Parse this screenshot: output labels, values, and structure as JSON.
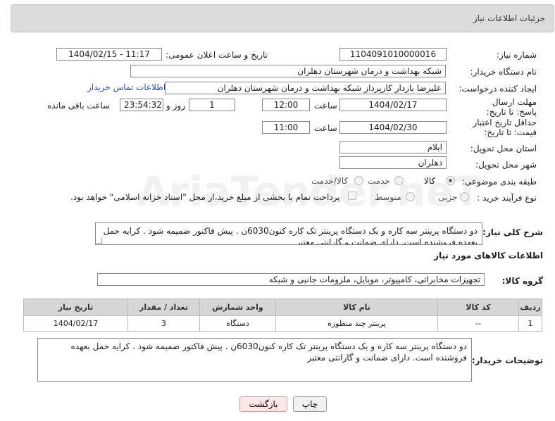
{
  "header": {
    "title": "جزئیات اطلاعات نیاز"
  },
  "fields": {
    "need_number_label": "شماره نیاز:",
    "need_number": "1104091010000016",
    "announce_label": "تاریخ و ساعت اعلان عمومی:",
    "announce_value": "1404/02/15 - 11:17",
    "buyer_org_label": "نام دستگاه خریدار:",
    "buyer_org": "شبکه بهداشت و درمان شهرستان دهلران",
    "creator_label": "ایجاد کننده درخواست:",
    "creator": "علیرضا بازدار کارپرداز شبکه بهداشت و درمان شهرستان دهلران",
    "buyer_contact_link": "اطلاعات تماس خریدار",
    "deadline_label": "مهلت ارسال پاسخ: تا تاریخ:",
    "deadline_date": "1404/02/17",
    "time_label": "ساعت",
    "deadline_time": "12:00",
    "days_value": "1",
    "days_label": "روز و",
    "remaining_value": "23:54:32",
    "remaining_label": "ساعت باقی مانده",
    "price_validity_label": "حداقل تاریخ اعتبار قیمت: تا تاریخ:",
    "price_date": "1404/02/30",
    "price_time": "11:00",
    "province_label": "استان محل تحویل:",
    "province": "ایلام",
    "city_label": "شهر محل تحویل:",
    "city": "دهلران",
    "category_label": "طبقه بندی موضوعی:",
    "cat_goods": "کالا",
    "cat_service": "خدمت",
    "cat_goods_service": "کالا/خدمت",
    "process_label": "نوع فرآیند خرید :",
    "proc_partial": "جزیی",
    "proc_medium": "متوسط",
    "payment_note": "پرداخت تمام یا بخشی از مبلغ خرید،از محل \"اسناد خزانه اسلامی\" خواهد بود."
  },
  "description": {
    "label": "شرح کلی نیاز:",
    "text": "دو دستگاه پرینتر سه کاره و یک دستگاه پرینتر تک کاره کنون6030ن . پیش فاکتور ضمیمه شود . کرایه حمل بعهده فروشنده است. دارای ضمانت و گارانتی معتبر"
  },
  "goods_section": {
    "title": "اطلاعات کالاهای مورد نیاز"
  },
  "group": {
    "label": "گروه کالا:",
    "value": "تجهیزات مخابراتی، کامپیوتر، موبایل، ملزومات جانبی و شبکه"
  },
  "table": {
    "headers": [
      "ردیف",
      "کد کالا",
      "نام کالا",
      "واحد شمارش",
      "تعداد / مقدار",
      "تاریخ نیاز"
    ],
    "rows": [
      [
        "1",
        "--",
        "پرینتر چند منظوره",
        "دستگاه",
        "3",
        "1404/02/17"
      ]
    ]
  },
  "buyer_notes": {
    "label": "توضیحات خریدار:",
    "text": "دو دستگاه پرینتر سه کاره و یک دستگاه پرینتر تک کاره کنون6030ن . پیش فاکتور ضمیمه شود . کرایه حمل بعهده فروشنده است. دارای ضمانت و گارانتی معتبر"
  },
  "buttons": {
    "print": "چاپ",
    "back": "بازگشت"
  },
  "watermark": "AriaTender.neT"
}
